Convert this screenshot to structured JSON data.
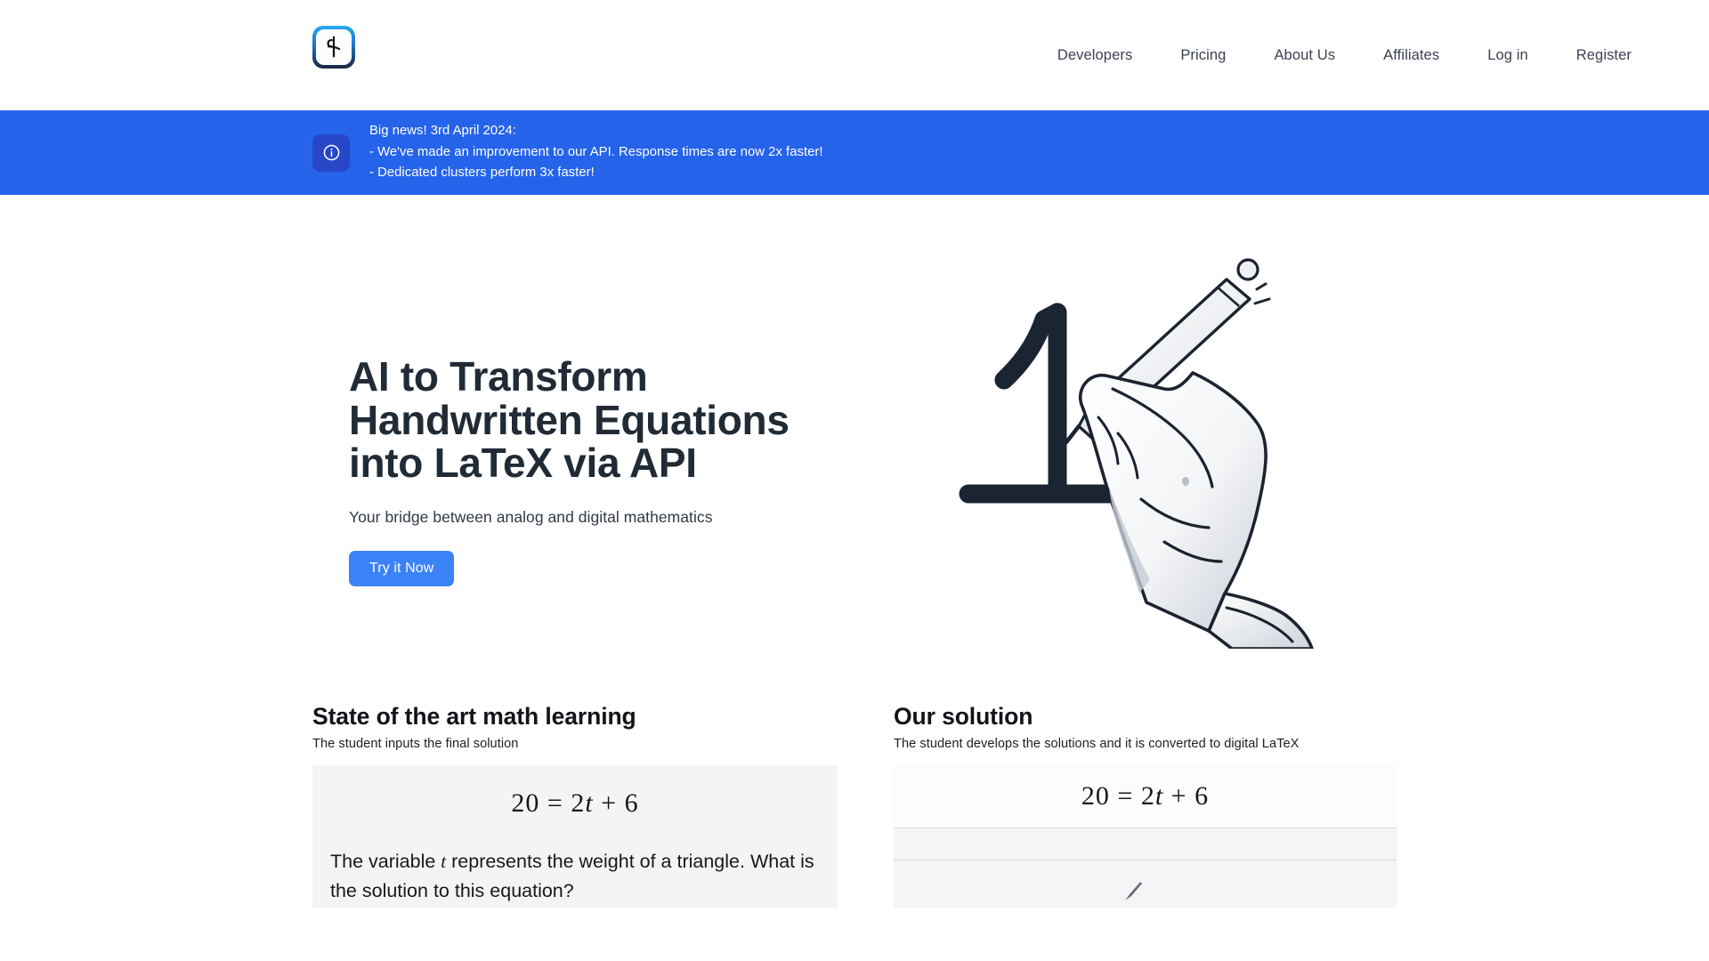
{
  "header": {
    "logo_name": "mathpix-style-pen-logo",
    "nav": [
      {
        "label": "Developers"
      },
      {
        "label": "Pricing"
      },
      {
        "label": "About Us"
      },
      {
        "label": "Affiliates"
      },
      {
        "label": "Log in"
      },
      {
        "label": "Register"
      }
    ]
  },
  "banner": {
    "icon": "info-icon",
    "background_color": "#2563eb",
    "icon_background_color": "#2747c8",
    "line1": "Big news! 3rd April 2024:",
    "line2": "- We've made an improvement to our API. Response times are now 2x faster!",
    "line3": "- Dedicated clusters perform 3x faster!"
  },
  "hero": {
    "title_line1": "AI to Transform",
    "title_line2": "Handwritten Equations",
    "title_line3": "into LaTeX via API",
    "subtitle": "Your bridge between analog and digital mathematics",
    "cta_label": "Try it Now",
    "cta_color": "#3b82f6",
    "illustration": "robotic-hand-writing-number-one-with-pen"
  },
  "sections": {
    "left": {
      "title": "State of the art math learning",
      "subtitle": "The student inputs the final solution",
      "equation_pre": "20 = 2",
      "equation_var": "t",
      "equation_post": " + 6",
      "body_pre": "The variable ",
      "body_var": "t",
      "body_post": " represents the weight of a triangle. What is the solution to this equation?",
      "panel_background": "#f4f4f5"
    },
    "right": {
      "title": "Our solution",
      "subtitle": "The student develops the solutions and it is converted to digital LaTeX",
      "equation_pre": "20 = 2",
      "equation_var": "t",
      "equation_post": " + 6",
      "panel_background": "#fcfcfd",
      "row_background": "#f5f5f7",
      "row_divider_color": "#d7d7db"
    }
  }
}
